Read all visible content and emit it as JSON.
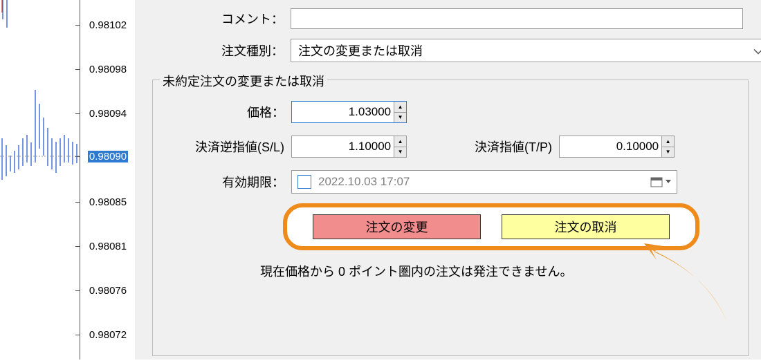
{
  "y_axis": {
    "ticks": [
      "0.98102",
      "0.98098",
      "0.98094",
      "0.98090",
      "0.98085",
      "0.98081",
      "0.98076",
      "0.98072"
    ],
    "highlighted": "0.98090"
  },
  "form": {
    "comment_label": "コメント：",
    "order_type_label": "注文種別：",
    "order_type_value": "注文の変更または取消"
  },
  "fieldset": {
    "legend": "未約定注文の変更または取消",
    "price_label": "価格：",
    "price_value": "1.03000",
    "sl_label": "決済逆指値(S/L)",
    "sl_value": "1.10000",
    "tp_label": "決済指値(T/P)",
    "tp_value": "0.10000",
    "expiry_label": "有効期限：",
    "expiry_value": "2022.10.03 17:07"
  },
  "buttons": {
    "modify": "注文の変更",
    "cancel": "注文の取消"
  },
  "note": "現在価格から 0 ポイント圏内の注文は発注できません。",
  "colors": {
    "highlight_orange": "#ee8b1a",
    "btn_red": "#f28d8d",
    "btn_yellow": "#feff9e",
    "axis_highlight": "#2d7ad0"
  }
}
